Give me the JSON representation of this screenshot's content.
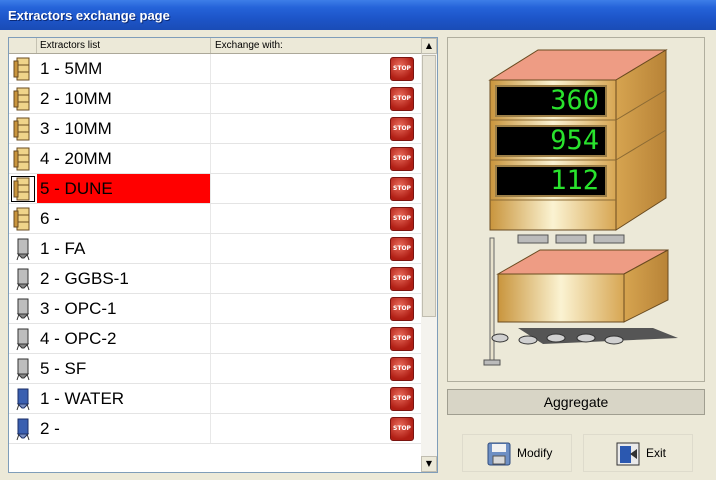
{
  "window": {
    "title": "Extractors exchange page"
  },
  "list": {
    "columns": {
      "extractors": "Extractors list",
      "exchange": "Exchange with:"
    },
    "rows": [
      {
        "name": "1 - 5MM",
        "icon": "sand-stack-icon",
        "selected": false
      },
      {
        "name": "2 - 10MM",
        "icon": "sand-stack-icon",
        "selected": false
      },
      {
        "name": "3 - 10MM",
        "icon": "sand-stack-icon",
        "selected": false
      },
      {
        "name": "4 - 20MM",
        "icon": "sand-stack-icon",
        "selected": false
      },
      {
        "name": "5 - DUNE",
        "icon": "sand-stack-icon",
        "selected": true
      },
      {
        "name": "6 -",
        "icon": "sand-stack-icon",
        "selected": false
      },
      {
        "name": "1 - FA",
        "icon": "cement-silo-icon",
        "selected": false
      },
      {
        "name": "2 - GGBS-1",
        "icon": "cement-silo-icon",
        "selected": false
      },
      {
        "name": "3 - OPC-1",
        "icon": "cement-silo-icon",
        "selected": false
      },
      {
        "name": "4 - OPC-2",
        "icon": "cement-silo-icon",
        "selected": false
      },
      {
        "name": "5 - SF",
        "icon": "cement-silo-icon",
        "selected": false
      },
      {
        "name": "1 - WATER",
        "icon": "water-tank-icon",
        "selected": false
      },
      {
        "name": "2 -",
        "icon": "water-tank-icon",
        "selected": false
      }
    ],
    "stop_label": "STOP"
  },
  "display": {
    "values": [
      "360",
      "954",
      "112"
    ]
  },
  "aggregate_label": "Aggregate",
  "buttons": {
    "modify": "Modify",
    "exit": "Exit"
  },
  "colors": {
    "selection": "#ff0000",
    "lcd_text": "#29e22d",
    "titlebar": "#2563d9"
  }
}
